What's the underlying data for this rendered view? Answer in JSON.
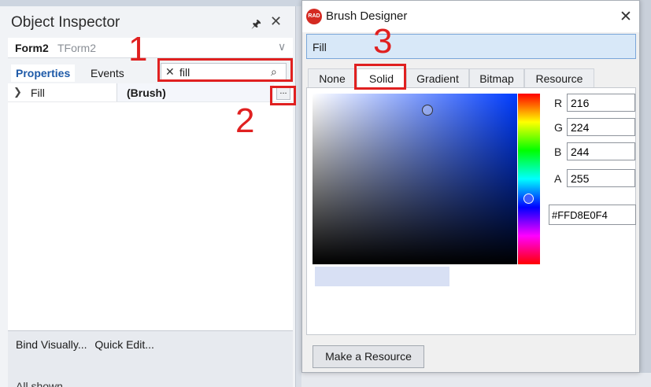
{
  "object_inspector": {
    "title": "Object Inspector",
    "pin_icon": "pin-icon",
    "close_icon": "close-icon",
    "component": {
      "name": "Form2",
      "type": "TForm2"
    },
    "tabs": [
      {
        "label": "Properties",
        "active": true
      },
      {
        "label": "Events",
        "active": false
      }
    ],
    "search": {
      "value": "fill",
      "clear_icon": "clear-x-icon",
      "search_icon": "search-icon"
    },
    "properties": [
      {
        "name": "Fill",
        "value": "(Brush)",
        "editor_button": "..."
      }
    ],
    "footer": {
      "links": [
        "Bind Visually...",
        "Quick Edit..."
      ],
      "status": "All shown"
    }
  },
  "annotations": [
    {
      "number": "1"
    },
    {
      "number": "2"
    },
    {
      "number": "3"
    }
  ],
  "brush_designer": {
    "title": "Brush Designer",
    "logo_text": "RAD",
    "brush_name": "Fill",
    "tabs": [
      {
        "label": "None",
        "active": false
      },
      {
        "label": "Solid",
        "active": true
      },
      {
        "label": "Gradient",
        "active": false
      },
      {
        "label": "Bitmap",
        "active": false
      },
      {
        "label": "Resource",
        "active": false
      }
    ],
    "color": {
      "r_label": "R",
      "r": "216",
      "g_label": "G",
      "g": "224",
      "b_label": "B",
      "b": "244",
      "a_label": "A",
      "a": "255",
      "hex": "#FFD8E0F4",
      "preview_color": "#d8e0f4"
    },
    "make_resource_label": "Make a Resource"
  },
  "colors": {
    "annotation_red": "#e02020",
    "accent_blue": "#1e5aa8"
  }
}
